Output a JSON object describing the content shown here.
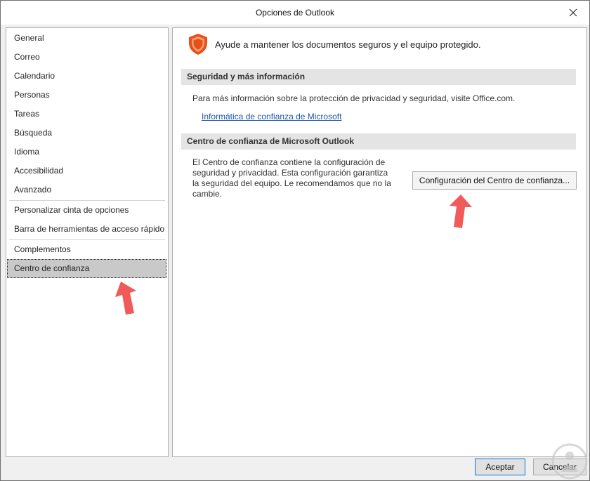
{
  "window": {
    "title": "Opciones de Outlook"
  },
  "sidebar": {
    "items": [
      {
        "label": "General"
      },
      {
        "label": "Correo"
      },
      {
        "label": "Calendario"
      },
      {
        "label": "Personas"
      },
      {
        "label": "Tareas"
      },
      {
        "label": "Búsqueda"
      },
      {
        "label": "Idioma"
      },
      {
        "label": "Accesibilidad"
      },
      {
        "label": "Avanzado"
      },
      {
        "label": "Personalizar cinta de opciones"
      },
      {
        "label": "Barra de herramientas de acceso rápido"
      },
      {
        "label": "Complementos"
      },
      {
        "label": "Centro de confianza"
      }
    ],
    "selected": "Centro de confianza"
  },
  "content": {
    "header": "Ayude a mantener los documentos seguros y el equipo protegido.",
    "header_icon": "shield-icon",
    "section1": {
      "title": "Seguridad y más información",
      "text": "Para más información sobre la protección de privacidad y seguridad, visite Office.com.",
      "link": "Informática de confianza de Microsoft"
    },
    "section2": {
      "title": "Centro de confianza de Microsoft Outlook",
      "text": "El Centro de confianza contiene la configuración de seguridad y privacidad. Esta configuración garantiza la seguridad del equipo. Le recomendamos que no la cambie.",
      "button": "Configuración del Centro de confianza..."
    }
  },
  "footer": {
    "ok": "Aceptar",
    "cancel": "Cancelar"
  },
  "colors": {
    "shield": "#e8501b",
    "annotation_arrow": "#f05a5a",
    "link": "#2057a7",
    "selected_item": "#c9c9c9"
  }
}
